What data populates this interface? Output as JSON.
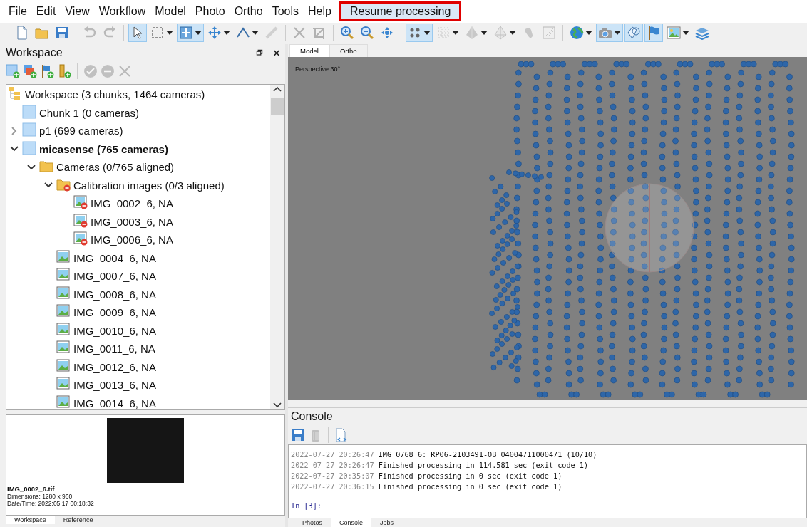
{
  "menu": [
    {
      "label": "File"
    },
    {
      "label": "Edit"
    },
    {
      "label": "View"
    },
    {
      "label": "Workflow"
    },
    {
      "label": "Model"
    },
    {
      "label": "Photo"
    },
    {
      "label": "Ortho"
    },
    {
      "label": "Tools"
    },
    {
      "label": "Help"
    }
  ],
  "resume_button": {
    "label": "Resume processing"
  },
  "toolbar": [
    {
      "selected": false,
      "disabled": false,
      "dropdown": false
    },
    {
      "selected": false,
      "disabled": false,
      "dropdown": false
    },
    {
      "selected": false,
      "disabled": false,
      "dropdown": false
    },
    {
      "selected": false,
      "disabled": true,
      "dropdown": false
    },
    {
      "selected": false,
      "disabled": true,
      "dropdown": false
    },
    {
      "selected": true,
      "disabled": false,
      "dropdown": false
    },
    {
      "selected": false,
      "disabled": false,
      "dropdown": true
    },
    {
      "selected": true,
      "disabled": false,
      "dropdown": true
    },
    {
      "selected": false,
      "disabled": false,
      "dropdown": true
    },
    {
      "selected": false,
      "disabled": false,
      "dropdown": true
    },
    {
      "selected": false,
      "disabled": true,
      "dropdown": false
    },
    {
      "selected": false,
      "disabled": true,
      "dropdown": false
    },
    {
      "selected": false,
      "disabled": true,
      "dropdown": false
    },
    {
      "selected": false,
      "disabled": false,
      "dropdown": false
    },
    {
      "selected": false,
      "disabled": false,
      "dropdown": false
    },
    {
      "selected": false,
      "disabled": false,
      "dropdown": false
    },
    {
      "selected": true,
      "disabled": false,
      "dropdown": true
    },
    {
      "selected": false,
      "disabled": true,
      "dropdown": true
    },
    {
      "selected": false,
      "disabled": true,
      "dropdown": true
    },
    {
      "selected": false,
      "disabled": true,
      "dropdown": true
    },
    {
      "selected": false,
      "disabled": true,
      "dropdown": false
    },
    {
      "selected": false,
      "disabled": true,
      "dropdown": false
    },
    {
      "selected": false,
      "disabled": false,
      "dropdown": true
    },
    {
      "selected": true,
      "disabled": false,
      "dropdown": true
    },
    {
      "selected": true,
      "disabled": false,
      "dropdown": false
    },
    {
      "selected": true,
      "disabled": false,
      "dropdown": false
    },
    {
      "selected": false,
      "disabled": false,
      "dropdown": true
    },
    {
      "selected": false,
      "disabled": false,
      "dropdown": false
    }
  ],
  "workspace": {
    "title": "Workspace",
    "toolbar": [
      {
        "disabled": false
      },
      {
        "disabled": false
      },
      {
        "disabled": false
      },
      {
        "disabled": false
      },
      {
        "disabled": true
      },
      {
        "disabled": true
      },
      {
        "disabled": true
      }
    ],
    "tree": [
      {
        "label": "Workspace (3 chunks, 1464 cameras)",
        "kind": "workspace",
        "children": [
          {
            "label": "Chunk 1 (0 cameras)",
            "kind": "chunk",
            "active": false
          },
          {
            "label": "p1 (699 cameras)",
            "kind": "chunk",
            "active": false,
            "expanded": false
          },
          {
            "label": "micasense (765 cameras)",
            "kind": "chunk",
            "active": true,
            "expanded": true,
            "children": [
              {
                "label": "Cameras (0/765 aligned)",
                "kind": "folder",
                "disabled": false,
                "expanded": true,
                "children": [
                  {
                    "label": "Calibration images (0/3 aligned)",
                    "kind": "folder",
                    "disabled": true,
                    "expanded": true,
                    "children": [
                      {
                        "label": "IMG_0002_6, NA",
                        "kind": "camera",
                        "disabled": true
                      },
                      {
                        "label": "IMG_0003_6, NA",
                        "kind": "camera",
                        "disabled": true
                      },
                      {
                        "label": "IMG_0006_6, NA",
                        "kind": "camera",
                        "disabled": true
                      }
                    ]
                  },
                  {
                    "label": "IMG_0004_6, NA",
                    "kind": "camera",
                    "disabled": false
                  },
                  {
                    "label": "IMG_0007_6, NA",
                    "kind": "camera",
                    "disabled": false
                  },
                  {
                    "label": "IMG_0008_6, NA",
                    "kind": "camera",
                    "disabled": false
                  },
                  {
                    "label": "IMG_0009_6, NA",
                    "kind": "camera",
                    "disabled": false
                  },
                  {
                    "label": "IMG_0010_6, NA",
                    "kind": "camera",
                    "disabled": false
                  },
                  {
                    "label": "IMG_0011_6, NA",
                    "kind": "camera",
                    "disabled": false
                  },
                  {
                    "label": "IMG_0012_6, NA",
                    "kind": "camera",
                    "disabled": false
                  },
                  {
                    "label": "IMG_0013_6, NA",
                    "kind": "camera",
                    "disabled": false
                  },
                  {
                    "label": "IMG_0014_6, NA",
                    "kind": "camera",
                    "disabled": false
                  }
                ]
              }
            ]
          }
        ]
      }
    ],
    "preview": {
      "filename": "IMG_0002_6.tif",
      "dimensions": "Dimensions: 1280 x 960",
      "datetime": "Date/Time: 2022:05:17 00:18:32"
    },
    "tabs": [
      {
        "label": "Workspace",
        "selected": true
      },
      {
        "label": "Reference",
        "selected": false
      }
    ]
  },
  "view": {
    "tabs": [
      {
        "label": "Model",
        "selected": true
      },
      {
        "label": "Ortho",
        "selected": false
      }
    ],
    "projection": "Perspective 30°"
  },
  "console": {
    "title": "Console",
    "toolbar": [
      {
        "disabled": false
      },
      {
        "disabled": true
      },
      {
        "disabled": false
      }
    ],
    "lines": [
      {
        "time": "2022-07-27 20:26:47",
        "text": "IMG_0768_6: RP06-2103491-OB_04004711000471 (10/10)"
      },
      {
        "time": "2022-07-27 20:26:47",
        "text": "Finished processing in 114.581 sec (exit code 1)"
      },
      {
        "time": "2022-07-27 20:35:07",
        "text": "Finished processing in 0 sec (exit code 1)"
      },
      {
        "time": "2022-07-27 20:36:15",
        "text": "Finished processing in 0 sec (exit code 1)"
      }
    ],
    "prompt": "In [3]:",
    "tabs": [
      {
        "label": "Photos",
        "selected": false
      },
      {
        "label": "Console",
        "selected": true
      },
      {
        "label": "Jobs",
        "selected": false
      }
    ]
  }
}
